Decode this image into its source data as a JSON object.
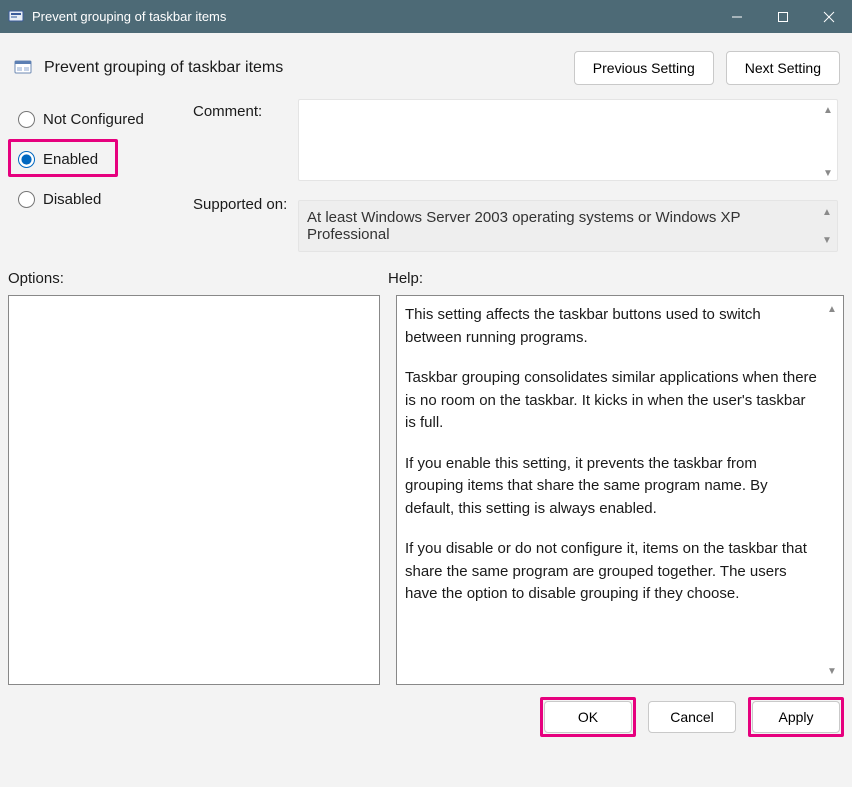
{
  "window": {
    "title": "Prevent grouping of taskbar items"
  },
  "header": {
    "policy_title": "Prevent grouping of taskbar items",
    "prev_btn": "Previous Setting",
    "next_btn": "Next Setting"
  },
  "state": {
    "not_configured": "Not Configured",
    "enabled": "Enabled",
    "disabled": "Disabled",
    "selected": "enabled"
  },
  "labels": {
    "comment": "Comment:",
    "supported": "Supported on:",
    "options": "Options:",
    "help": "Help:"
  },
  "fields": {
    "comment_value": "",
    "supported_value": "At least Windows Server 2003 operating systems or Windows XP Professional"
  },
  "help": {
    "p1": "This setting affects the taskbar buttons used to switch between running programs.",
    "p2": "Taskbar grouping consolidates similar applications when there is no room on the taskbar. It kicks in when the user's taskbar is full.",
    "p3": "If you enable this setting, it prevents the taskbar from grouping items that share the same program name. By default, this setting is always enabled.",
    "p4": "If you disable or do not configure it, items on the taskbar that share the same program are grouped together. The users have the option to disable grouping if they choose."
  },
  "footer": {
    "ok": "OK",
    "cancel": "Cancel",
    "apply": "Apply"
  }
}
